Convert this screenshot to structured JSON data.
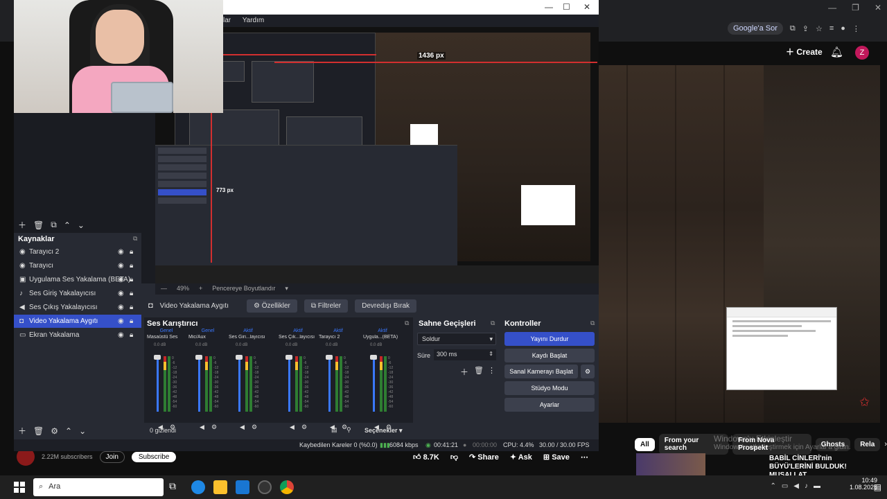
{
  "obs": {
    "menu": [
      "lar",
      "Yardım"
    ],
    "preview_px_label": "1436 px",
    "preview_px_label2": "773 px",
    "zoom_text": "49%",
    "zoom_plus": "+",
    "zoom_mode": "Pencereye Boyutlandır",
    "sources_title": "Kaynaklar",
    "sources": [
      {
        "label": "Tarayıcı 2",
        "icon": "globe-icon"
      },
      {
        "label": "Tarayıcı",
        "icon": "globe-icon"
      },
      {
        "label": "Uygulama Ses Yakalama (BETA)",
        "icon": "app-audio-icon"
      },
      {
        "label": "Ses Giriş Yakalayıcısı",
        "icon": "mic-icon"
      },
      {
        "label": "Ses Çıkış Yakalayıcısı",
        "icon": "speaker-icon"
      },
      {
        "label": "Video Yakalama Aygıtı",
        "icon": "camera-icon",
        "selected": true
      },
      {
        "label": "Ekran Yakalama",
        "icon": "monitor-icon"
      }
    ],
    "context": {
      "source_name": "Video Yakalama Aygıtı",
      "properties": "Özellikler",
      "filters": "Filtreler",
      "deactivate": "Devredışı Bırak"
    },
    "mixer": {
      "title": "Ses Karıştırıcı",
      "channels": [
        {
          "state": "Genel",
          "name": "Masaüstü Ses",
          "db": "0.0 dB"
        },
        {
          "state": "Genel",
          "name": "Mic/Aux",
          "db": "0.0 dB"
        },
        {
          "state": "Aktif",
          "name": "Ses Giri...layıcısı",
          "db": "0.0 dB"
        },
        {
          "state": "Aktif",
          "name": "Ses Çık...layıcısı",
          "db": "0.0 dB"
        },
        {
          "state": "Aktif",
          "name": "Tarayıcı 2",
          "db": "0.0 dB"
        },
        {
          "state": "Aktif",
          "name": "Uygula...(BETA)",
          "db": "0.0 dB"
        }
      ],
      "scale": [
        "0",
        "-6",
        "-12",
        "-18",
        "-24",
        "-30",
        "-36",
        "-42",
        "-48",
        "-54",
        "-60"
      ],
      "hidden_count": "0 gizlendi",
      "options": "Seçenekler"
    },
    "transitions": {
      "title": "Sahne Geçişleri",
      "selected": "Soldur",
      "duration_label": "Süre",
      "duration_value": "300 ms"
    },
    "controls": {
      "title": "Kontroller",
      "stop_stream": "Yayını Durdur",
      "start_record": "Kaydı Başlat",
      "virtual_cam": "Sanal Kamerayı Başlat",
      "studio_mode": "Stüdyo Modu",
      "settings": "Ayarlar"
    },
    "status": {
      "dropped": "Kaybedilen Kareler 0 (%0.0)",
      "bitrate": "6084 kbps",
      "stream_time": "00:41:21",
      "record_time": "00:00:00",
      "cpu": "CPU: 4.4%",
      "fps": "30.00 / 30.00 FPS"
    }
  },
  "chrome": {
    "google_sor": "Google'a Sor",
    "create": "Create",
    "avatar": "Z",
    "chips": [
      "All",
      "From your search",
      "From Nova Prospekt",
      "Ghosts",
      "Rela"
    ],
    "watermark": "Windows'u Etkinleştir",
    "watermark_sub": "Windows'u etkinleştirmek için Ayarlar'a gidin.",
    "channel_subs": "2.22M subscribers",
    "join": "Join",
    "subscribe": "Subscribe",
    "likes": "8.7K",
    "share": "Share",
    "ask": "Ask",
    "save": "Save",
    "rec_title": "BABİL CİNLERİ'nin BÜYÜ'LERİNİ BULDUK! MUSALLAT ..."
  },
  "taskbar": {
    "search_placeholder": "Ara",
    "time": "10:49",
    "date": "1.08.2026"
  }
}
